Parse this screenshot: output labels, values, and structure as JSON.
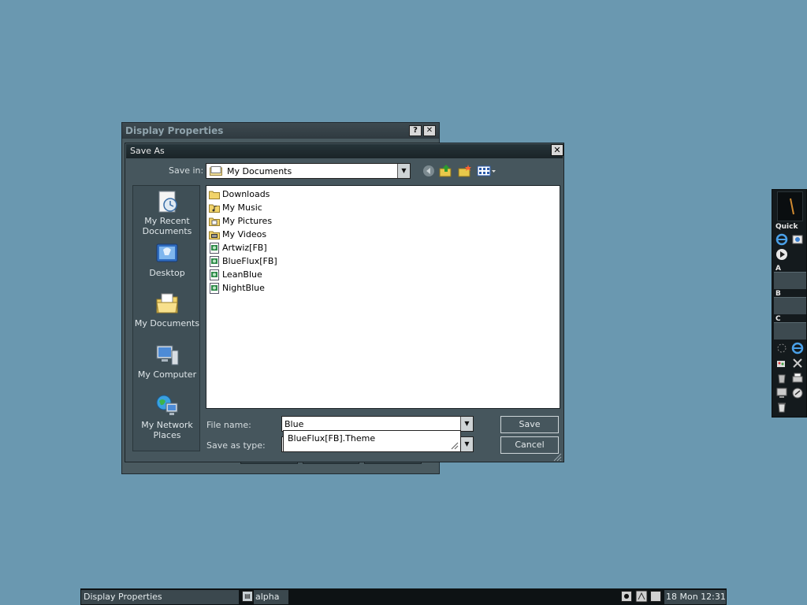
{
  "display_properties": {
    "title": "Display Properties",
    "help_label": "?",
    "close_label": "✕"
  },
  "save_as": {
    "title": "Save As",
    "close_label": "✕",
    "save_in_label": "Save in:",
    "save_in_value": "My Documents",
    "toolbar_icons": [
      "back-icon",
      "up-folder-icon",
      "new-folder-icon",
      "view-menu-icon"
    ],
    "places": [
      {
        "label": "My Recent Documents",
        "icon": "recent-documents-icon"
      },
      {
        "label": "Desktop",
        "icon": "desktop-icon"
      },
      {
        "label": "My Documents",
        "icon": "my-documents-icon"
      },
      {
        "label": "My Computer",
        "icon": "my-computer-icon"
      },
      {
        "label": "My Network Places",
        "icon": "network-places-icon"
      }
    ],
    "files": [
      {
        "name": "Downloads",
        "icon": "folder-icon"
      },
      {
        "name": "My Music",
        "icon": "music-folder-icon"
      },
      {
        "name": "My Pictures",
        "icon": "pictures-folder-icon"
      },
      {
        "name": "My Videos",
        "icon": "videos-folder-icon"
      },
      {
        "name": "Artwiz[FB]",
        "icon": "theme-file-icon"
      },
      {
        "name": "BlueFlux[FB]",
        "icon": "theme-file-icon"
      },
      {
        "name": "LeanBlue",
        "icon": "theme-file-icon"
      },
      {
        "name": "NightBlue",
        "icon": "theme-file-icon"
      }
    ],
    "file_name_label": "File name:",
    "file_name_value": "Blue",
    "save_as_type_label": "Save as type:",
    "autocomplete_suggestion": "BlueFlux[FB].Theme",
    "save_label": "Save",
    "cancel_label": "Cancel"
  },
  "dock": {
    "quick_label": "Quick",
    "sections": [
      "A",
      "B",
      "C"
    ]
  },
  "taskbar": {
    "task_display_properties": "Display Properties",
    "task_alpha": "alpha",
    "clock": "18 Mon 12:31"
  },
  "colors": {
    "desktop": "#6a98b0",
    "dialog": "#46565d",
    "titlebar": "#1a2428"
  }
}
